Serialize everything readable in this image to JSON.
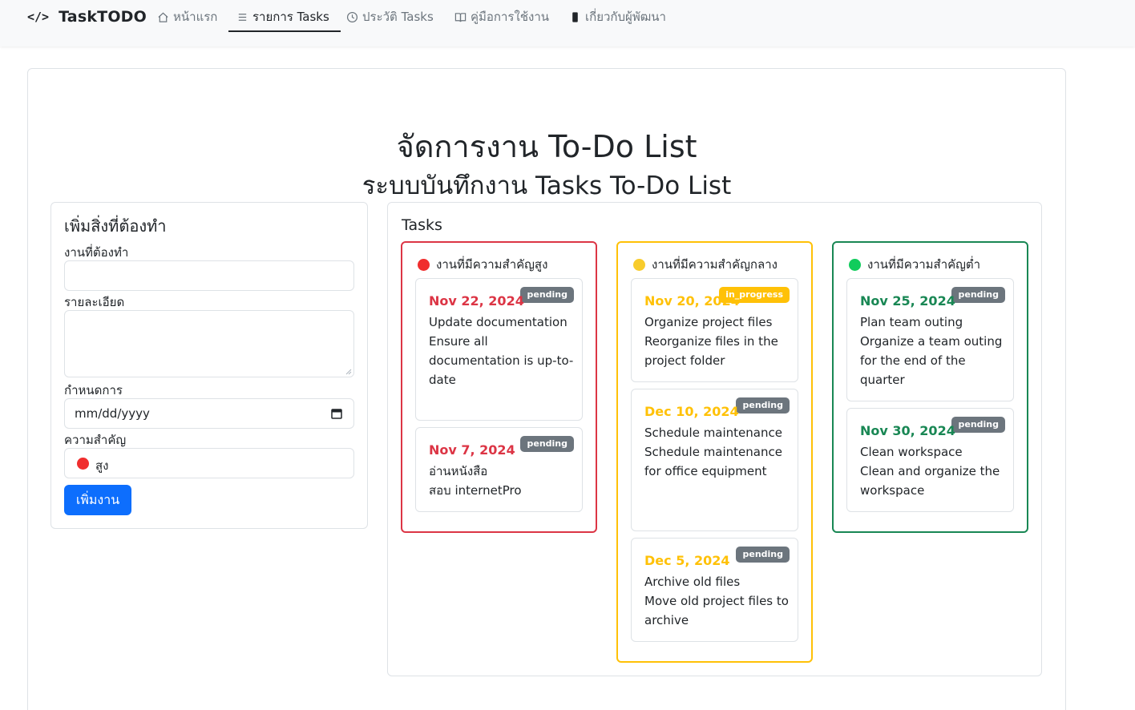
{
  "navbar": {
    "brand_icon": "</>",
    "brand": "TaskTODO",
    "items": [
      {
        "label": "หน้าแรก",
        "icon": "home-icon"
      },
      {
        "label": "รายการ Tasks",
        "icon": "list-icon"
      },
      {
        "label": "ประวัติ Tasks",
        "icon": "clock-icon"
      },
      {
        "label": "คู่มือการใช้งาน",
        "icon": "book-icon"
      },
      {
        "label": "เกี่ยวกับผู้พัฒนา",
        "icon": "phone-icon"
      }
    ],
    "active_index": 1
  },
  "page": {
    "title": "จัดการงาน To-Do List",
    "subtitle": "ระบบบันทึกงาน Tasks To-Do List"
  },
  "form": {
    "heading": "เพิ่มสิ่งที่ต้องทำ",
    "task_label": "งานที่ต้องทำ",
    "task_value": "",
    "detail_label": "รายละเอียด",
    "detail_value": "",
    "due_label": "กำหนดการ",
    "due_placeholder": "mm/dd/yyyy",
    "priority_label": "ความสำคัญ",
    "priority_value": "สูง",
    "submit_label": "เพิ่มงาน"
  },
  "tasks": {
    "title": "Tasks",
    "columns": [
      {
        "heading": "งานที่มีความสำคัญสูง",
        "color": "#dc3545",
        "dot_color": "#f02e2e",
        "cards": [
          {
            "date": "Nov 22, 2024",
            "title": "Update documentation",
            "detail": "Ensure all documentation is up-to-date",
            "status": "pending"
          },
          {
            "date": "Nov 7, 2024",
            "title": "อ่านหนังสือ",
            "detail": "สอบ internetPro",
            "status": "pending"
          }
        ]
      },
      {
        "heading": "งานที่มีความสำคัญกลาง",
        "color": "#ffc107",
        "dot_color": "#f8cc2c",
        "cards": [
          {
            "date": "Nov 20, 2024",
            "title": "Organize project files",
            "detail": "Reorganize files in the project folder",
            "status": "in_progress"
          },
          {
            "date": "Dec 10, 2024",
            "title": "Schedule maintenance",
            "detail": "Schedule maintenance for office equipment",
            "status": "pending"
          },
          {
            "date": "Dec 5, 2024",
            "title": "Archive old files",
            "detail": "Move old project files to archive",
            "status": "pending"
          }
        ]
      },
      {
        "heading": "งานที่มีความสำคัญต่ำ",
        "color": "#198754",
        "dot_color": "#10cc5c",
        "cards": [
          {
            "date": "Nov 25, 2024",
            "title": "Plan team outing",
            "detail": "Organize a team outing for the end of the quarter",
            "status": "pending"
          },
          {
            "date": "Nov 30, 2024",
            "title": "Clean workspace",
            "detail": "Clean and organize the workspace",
            "status": "pending"
          }
        ]
      }
    ]
  }
}
